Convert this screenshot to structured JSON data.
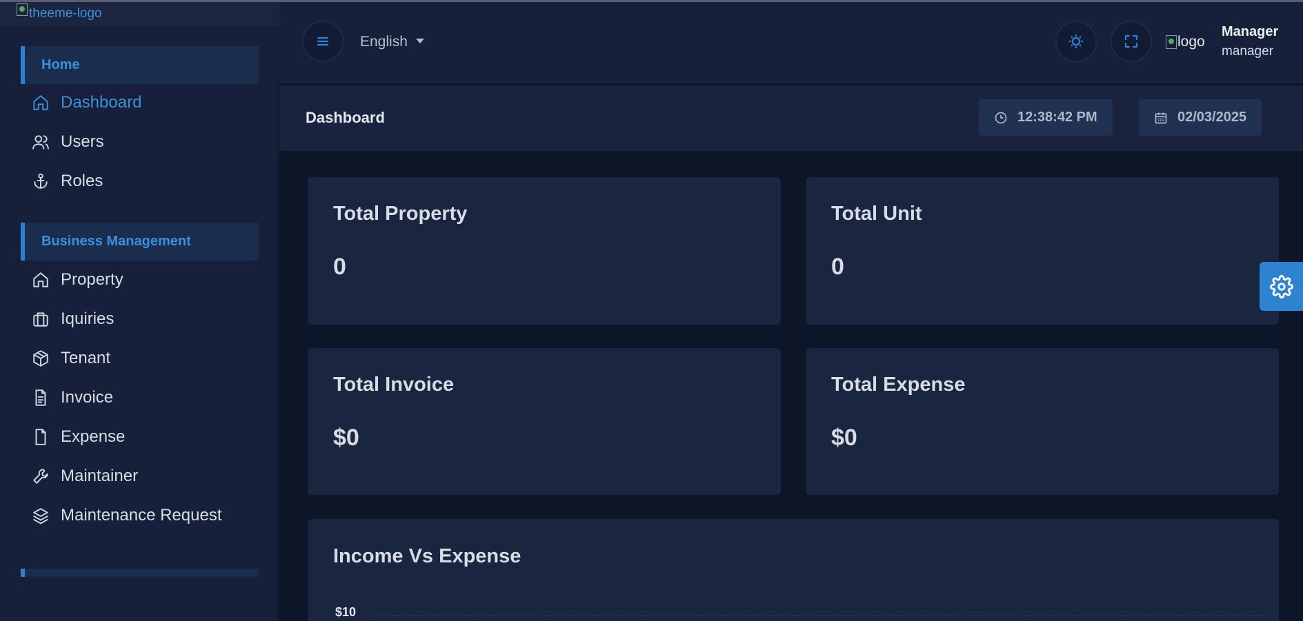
{
  "brand": {
    "logo_alt": "theeme-logo"
  },
  "sidebar": {
    "sections": [
      {
        "label": "Home"
      },
      {
        "label": "Business Management"
      }
    ],
    "home_items": [
      {
        "label": "Dashboard",
        "icon": "home-icon"
      },
      {
        "label": "Users",
        "icon": "users-icon"
      },
      {
        "label": "Roles",
        "icon": "anchor-icon"
      }
    ],
    "business_items": [
      {
        "label": "Property",
        "icon": "home-icon"
      },
      {
        "label": "Iquiries",
        "icon": "briefcase-icon"
      },
      {
        "label": "Tenant",
        "icon": "box-icon"
      },
      {
        "label": "Invoice",
        "icon": "file-text-icon"
      },
      {
        "label": "Expense",
        "icon": "file-icon"
      },
      {
        "label": "Maintainer",
        "icon": "wrench-icon"
      },
      {
        "label": "Maintenance Request",
        "icon": "layers-icon"
      }
    ]
  },
  "header": {
    "language": "English",
    "user_logo_alt": "logo",
    "user_name": "Manager",
    "user_role": "manager"
  },
  "subheader": {
    "title": "Dashboard",
    "time": "12:38:42 PM",
    "date": "02/03/2025"
  },
  "cards": [
    {
      "title": "Total Property",
      "value": "0"
    },
    {
      "title": "Total Unit",
      "value": "0"
    },
    {
      "title": "Total Invoice",
      "value": "$0"
    },
    {
      "title": "Total Expense",
      "value": "$0"
    }
  ],
  "chart": {
    "title": "Income Vs Expense",
    "top_tick": "$10"
  },
  "colors": {
    "accent": "#2e83d1",
    "background": "#0d1629",
    "panel": "#16203a",
    "card": "#1a2540"
  }
}
